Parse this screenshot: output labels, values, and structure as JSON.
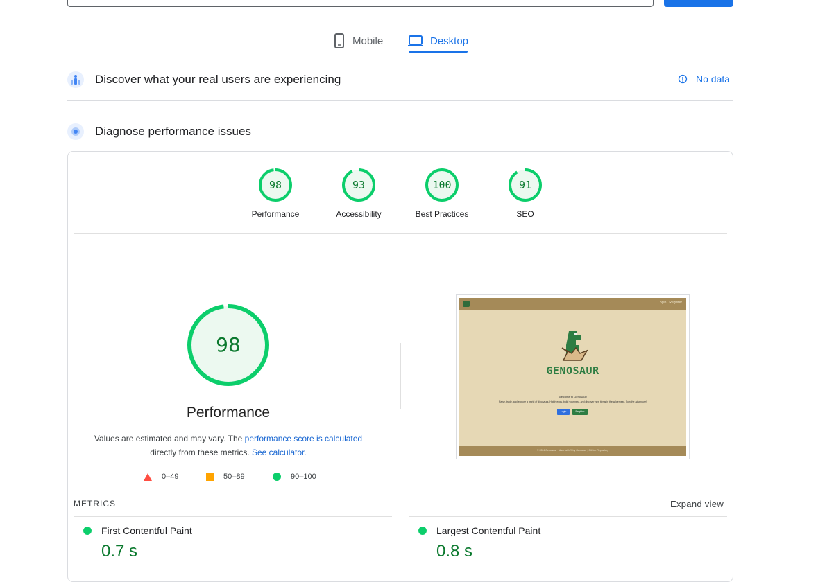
{
  "tabs": {
    "mobile_label": "Mobile",
    "desktop_label": "Desktop"
  },
  "field_data": {
    "title": "Discover what your real users are experiencing",
    "no_data_label": "No data"
  },
  "lab_data": {
    "title": "Diagnose performance issues"
  },
  "categories": [
    {
      "label": "Performance",
      "score": "98",
      "value": 98
    },
    {
      "label": "Accessibility",
      "score": "93",
      "value": 93
    },
    {
      "label": "Best Practices",
      "score": "100",
      "value": 100
    },
    {
      "label": "SEO",
      "score": "91",
      "value": 91
    }
  ],
  "performance": {
    "score": "98",
    "value": 98,
    "title": "Performance",
    "desc_prefix": "Values are estimated and may vary. The ",
    "desc_link": "performance score is calculated",
    "desc_mid": "directly from these metrics.",
    "desc_link2": "See calculator."
  },
  "legend": [
    {
      "range": "0–49",
      "color": "#ff4e42"
    },
    {
      "range": "50–89",
      "color": "#ffa400"
    },
    {
      "range": "90–100",
      "color": "#0cce6b"
    }
  ],
  "screenshot": {
    "nav_login": "Login",
    "nav_register": "Register",
    "logo_text": "GENOSAUR",
    "welcome": "Welcome to Genosaur!",
    "tagline": "Raise, trade, and explore a world of dinosaurs. Hatch eggs, build your nest, and discover new items in the wilderness. Join the adventure!",
    "login_btn": "Login",
    "register_btn": "Register",
    "footer": "© 2024 Genosaur · Made with ❤ by Genosaur | GitHub Repository"
  },
  "metrics": {
    "header": "METRICS",
    "expand_label": "Expand view",
    "items": [
      {
        "name": "First Contentful Paint",
        "value": "0.7 s"
      },
      {
        "name": "Largest Contentful Paint",
        "value": "0.8 s"
      }
    ]
  },
  "colors": {
    "pass": "#0cce6b",
    "pass_text": "#0c7a2f",
    "accent": "#1a73e8"
  }
}
